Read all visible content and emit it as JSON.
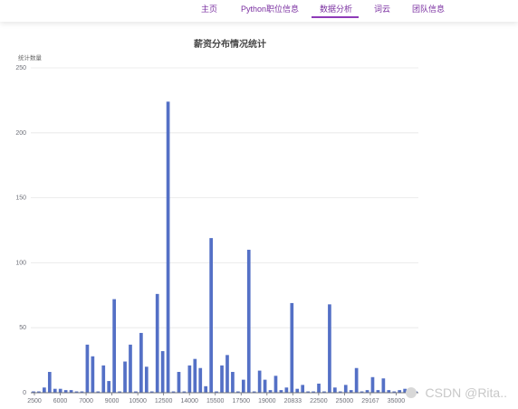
{
  "nav": {
    "items": [
      {
        "label": "主页"
      },
      {
        "label": "Python职位信息"
      },
      {
        "label": "数据分析"
      },
      {
        "label": "词云"
      },
      {
        "label": "团队信息"
      }
    ],
    "active_index": 2
  },
  "watermark": "CSDN @Rita..",
  "colors": {
    "accent": "#8e3bb8",
    "bar": "#5470c6"
  },
  "chart_data": {
    "type": "bar",
    "title": "薪资分布情况统计",
    "ylabel": "统计数量",
    "xlabel": "",
    "ylim": [
      0,
      250
    ],
    "yticks": [
      0,
      50,
      100,
      150,
      200,
      250
    ],
    "xtick_labels": [
      "2500",
      "6000",
      "7000",
      "9000",
      "10500",
      "12500",
      "14000",
      "15500",
      "17500",
      "19000",
      "20833",
      "22500",
      "25000",
      "29167",
      "35000"
    ],
    "values": [
      1,
      1,
      4,
      16,
      3,
      3,
      2,
      2,
      1,
      1,
      37,
      28,
      1,
      21,
      9,
      72,
      1,
      24,
      37,
      1,
      46,
      20,
      1,
      76,
      32,
      224,
      1,
      16,
      1,
      21,
      26,
      19,
      5,
      119,
      1,
      21,
      29,
      16,
      1,
      10,
      110,
      1,
      17,
      10,
      2,
      13,
      2,
      4,
      69,
      3,
      6,
      1,
      1,
      7,
      1,
      68,
      4,
      1,
      6,
      2,
      19,
      1,
      2,
      12,
      2,
      11,
      2,
      1,
      2,
      3,
      1,
      1
    ]
  }
}
